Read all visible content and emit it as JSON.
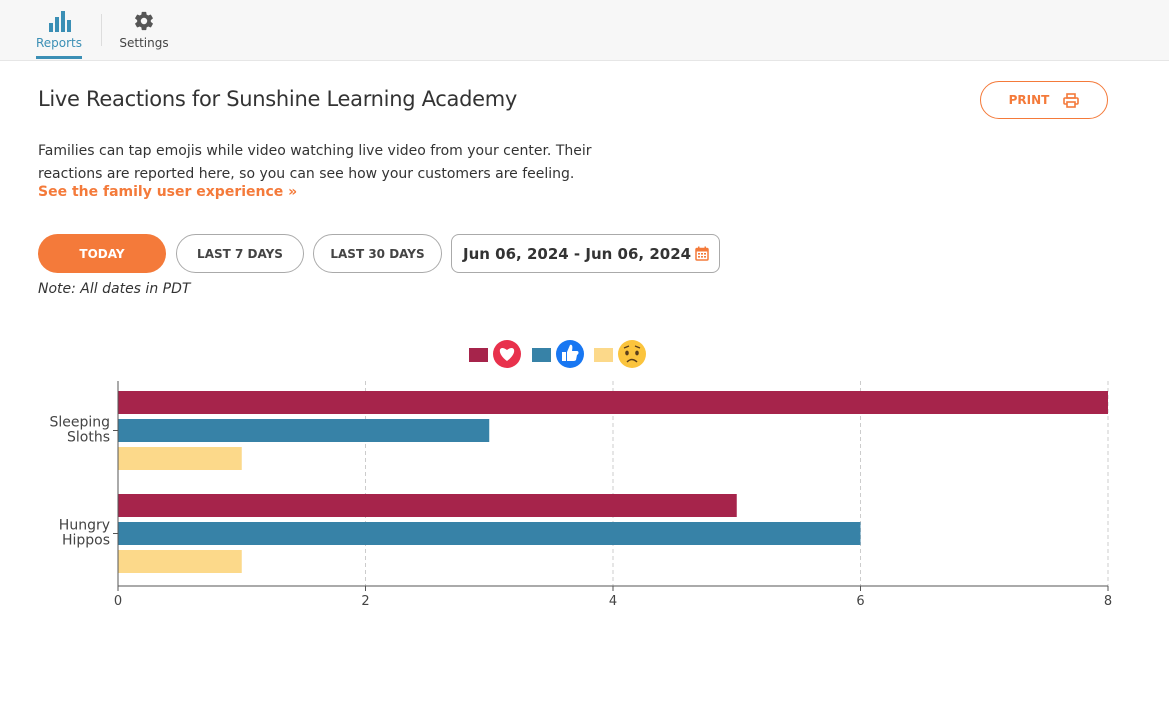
{
  "nav": {
    "items": [
      {
        "label": "Reports",
        "icon": "bar-chart-icon",
        "active": true
      },
      {
        "label": "Settings",
        "icon": "gear-icon",
        "active": false
      }
    ]
  },
  "page": {
    "title": "Live Reactions for Sunshine Learning Academy",
    "print_label": "PRINT",
    "description": "Families can tap emojis while video watching live video from your center. Their reactions are reported here, so you can see how your customers are feeling.",
    "family_link": "See the family user experience »",
    "note": "Note: All dates in PDT"
  },
  "filters": {
    "today": "TODAY",
    "last7": "LAST 7 DAYS",
    "last30": "LAST 30 DAYS",
    "date_range": "Jun 06, 2024 - Jun 06, 2024",
    "active": "today"
  },
  "colors": {
    "accent": "#f47a3a",
    "nav_active": "#3b8fb5",
    "love": "#a6244b",
    "like": "#3782a7",
    "sad": "#fcd98a"
  },
  "chart_data": {
    "type": "bar",
    "orientation": "horizontal",
    "title": "",
    "xlabel": "",
    "ylabel": "",
    "categories": [
      "Sleeping Sloths",
      "Hungry Hippos"
    ],
    "category_lines": [
      [
        "Sleeping",
        "Sloths"
      ],
      [
        "Hungry",
        "Hippos"
      ]
    ],
    "series": [
      {
        "name": "love",
        "icon": "heart-emoji-icon",
        "color": "#a6244b",
        "values": [
          8,
          5
        ]
      },
      {
        "name": "like",
        "icon": "thumbs-up-emoji-icon",
        "color": "#3782a7",
        "values": [
          3,
          6
        ]
      },
      {
        "name": "sad",
        "icon": "sad-face-emoji-icon",
        "color": "#fcd98a",
        "values": [
          1,
          1
        ]
      }
    ],
    "xlim": [
      0,
      8
    ],
    "xticks": [
      0,
      2,
      4,
      6,
      8
    ],
    "grid": "vertical dashed",
    "legend": "top-center"
  }
}
